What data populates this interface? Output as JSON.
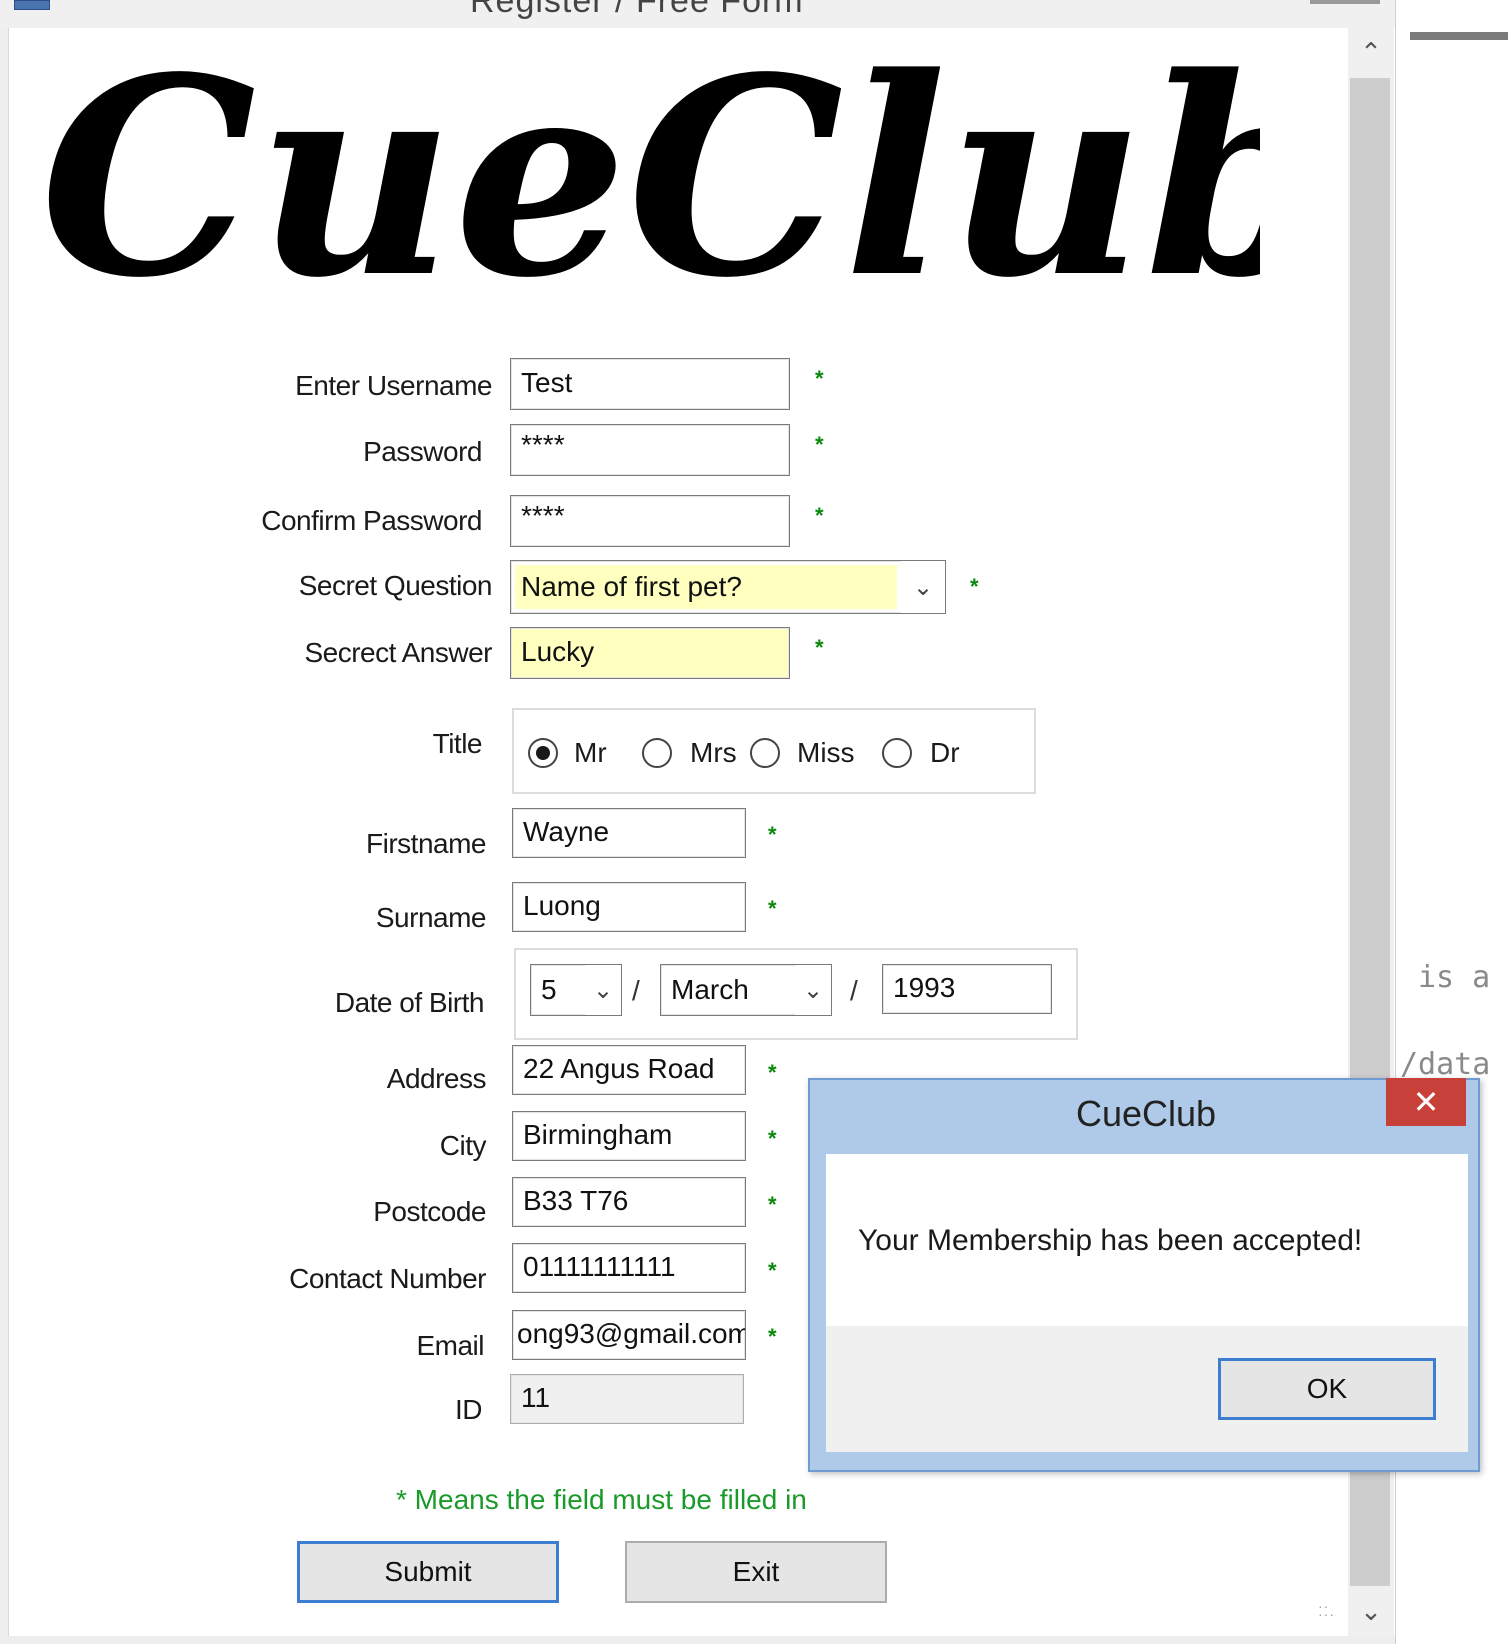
{
  "window": {
    "title": "Register / Free Form"
  },
  "logo": {
    "text": "CueClub"
  },
  "form": {
    "username": {
      "label": "Enter Username",
      "value": "Test",
      "required": "*"
    },
    "password": {
      "label": "Password",
      "value": "****",
      "required": "*"
    },
    "confirm_password": {
      "label": "Confirm Password",
      "value": "****",
      "required": "*"
    },
    "secret_question": {
      "label": "Secret Question",
      "value": "Name of first pet?",
      "required": "*"
    },
    "secret_answer": {
      "label": "Secrect Answer",
      "value": "Lucky",
      "required": "*"
    },
    "title": {
      "label": "Title",
      "options": [
        "Mr",
        "Mrs",
        "Miss",
        "Dr"
      ],
      "selected": "Mr"
    },
    "firstname": {
      "label": "Firstname",
      "value": "Wayne",
      "required": "*"
    },
    "surname": {
      "label": "Surname",
      "value": "Luong",
      "required": "*"
    },
    "dob": {
      "label": "Date of Birth",
      "day": "5",
      "month": "March",
      "year": "1993",
      "separator": "/"
    },
    "address": {
      "label": "Address",
      "value": "22 Angus Road",
      "required": "*"
    },
    "city": {
      "label": "City",
      "value": "Birmingham",
      "required": "*"
    },
    "postcode": {
      "label": "Postcode",
      "value": "B33 T76",
      "required": "*"
    },
    "contact": {
      "label": "Contact Number",
      "value": "01111111111",
      "required": "*"
    },
    "email": {
      "label": "Email",
      "value": "ong93@gmail.com",
      "required": "*"
    },
    "id": {
      "label": "ID",
      "value": "11"
    },
    "note": "* Means the field must be filled in",
    "submit_label": "Submit",
    "exit_label": "Exit"
  },
  "dialog": {
    "title": "CueClub",
    "message": "Your Membership has been accepted!",
    "ok_label": "OK",
    "close_glyph": "✕"
  },
  "background_editor": {
    "line1": "is a",
    "line2": "/data"
  },
  "colors": {
    "required_star": "#0a8a0a",
    "note_text": "#1a9a2a",
    "highlight_field": "#ffffc0",
    "dialog_frame": "#aecae8",
    "close_button": "#c7403a",
    "default_button_border": "#3c7fd1"
  },
  "icons": {
    "scroll_up": "chevron-up-icon",
    "scroll_down": "chevron-down-icon",
    "dropdown": "chevron-down-icon",
    "close": "close-icon",
    "grip": "resize-grip-icon"
  }
}
